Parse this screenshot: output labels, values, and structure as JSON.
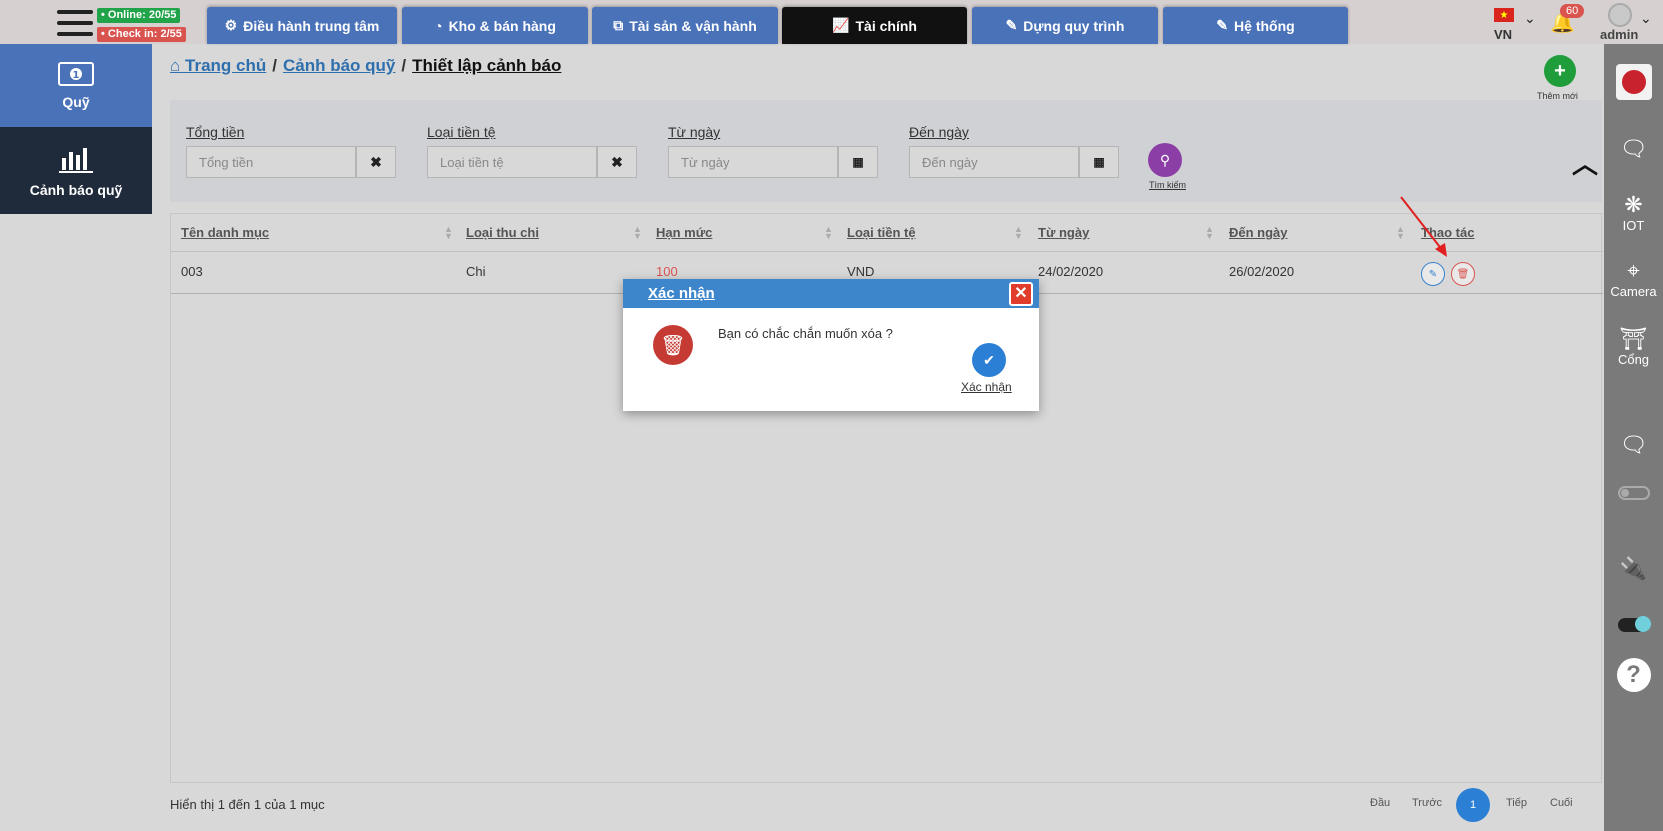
{
  "header": {
    "online_badge": "• Online: 20/55",
    "checkin_badge": "• Check in: 2/55",
    "tabs": [
      {
        "label": "Điều hành trung tâm",
        "icon": "gear-icon"
      },
      {
        "label": "Kho & bán hàng",
        "icon": "pie-chart-icon"
      },
      {
        "label": "Tài sản & vận hành",
        "icon": "cubes-icon"
      },
      {
        "label": "Tài chính",
        "icon": "line-chart-icon",
        "active": true
      },
      {
        "label": "Dựng quy trình",
        "icon": "edit-icon"
      },
      {
        "label": "Hệ thống",
        "icon": "edit-icon"
      }
    ],
    "language": "VN",
    "notification_count": "60",
    "username": "admin"
  },
  "sidebar_left": {
    "items": [
      {
        "label": "Quỹ",
        "icon": "money-icon"
      },
      {
        "label": "Cảnh báo quỹ",
        "icon": "bar-chart-icon"
      }
    ]
  },
  "sidebar_right": {
    "items": [
      {
        "label": "",
        "icon": "logo-icon"
      },
      {
        "label": "",
        "icon": "video-chat-icon"
      },
      {
        "label": "IOT",
        "icon": "iot-icon"
      },
      {
        "label": "Camera",
        "icon": "camera-icon"
      },
      {
        "label": "Cổng",
        "icon": "gate-icon"
      },
      {
        "label": "",
        "icon": "video-chat-icon"
      },
      {
        "label": "",
        "icon": "toggle-off-icon"
      },
      {
        "label": "",
        "icon": "plug-icon"
      },
      {
        "label": "",
        "icon": "toggle-on-icon"
      },
      {
        "label": "",
        "icon": "help-icon"
      }
    ]
  },
  "breadcrumb": {
    "home": "Trang chủ",
    "parent": "Cảnh báo quỹ",
    "current": "Thiết lập cảnh báo",
    "separator": "/"
  },
  "actions": {
    "add_label": "Thêm mới"
  },
  "filters": {
    "total": {
      "label": "Tổng tiền",
      "placeholder": "Tổng tiền"
    },
    "currency": {
      "label": "Loại tiền tệ",
      "placeholder": "Loại tiền tệ"
    },
    "from_date": {
      "label": "Từ ngày",
      "placeholder": "Từ ngày"
    },
    "to_date": {
      "label": "Đến ngày",
      "placeholder": "Đến ngày"
    },
    "search_label": "Tìm kiếm"
  },
  "table": {
    "columns": [
      "Tên danh mục",
      "Loại thu chi",
      "Hạn mức",
      "Loại tiền tệ",
      "Từ ngày",
      "Đến ngày",
      "Thao tác"
    ],
    "rows": [
      {
        "name": "003",
        "type": "Chi",
        "limit": "100",
        "currency": "VND",
        "from": "24/02/2020",
        "to": "26/02/2020"
      }
    ]
  },
  "footer": {
    "info": "Hiển thị 1 đến 1 của 1 mục",
    "first": "Đầu",
    "prev": "Trước",
    "page": "1",
    "next": "Tiếp",
    "last": "Cuối"
  },
  "modal": {
    "title": "Xác nhận",
    "message": "Bạn có chắc chắn muốn xóa ?",
    "confirm_label": "Xác nhận"
  },
  "colors": {
    "tab": "#4a72b8",
    "tab_active": "#111111",
    "danger": "#d9534f",
    "primary": "#2b7fd4",
    "success": "#1f9d3a",
    "search": "#8b3ea6"
  }
}
